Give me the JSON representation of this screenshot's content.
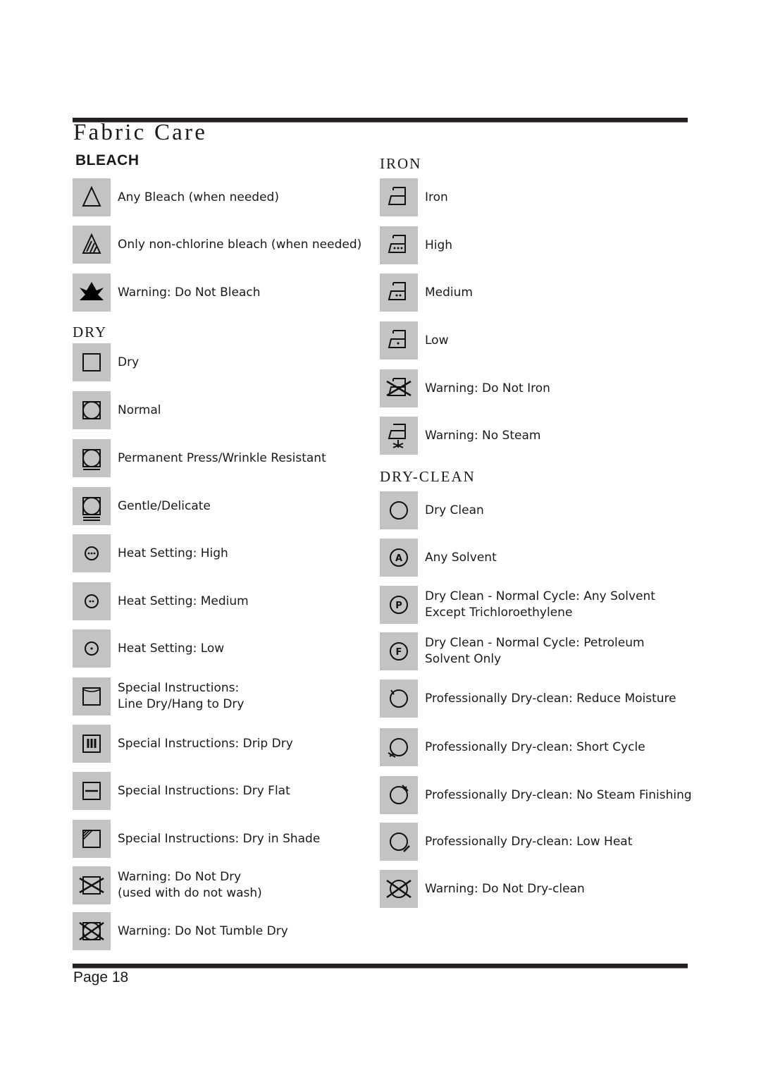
{
  "page": {
    "title": "Fabric Care",
    "footer": "Page 18"
  },
  "sections": {
    "bleach": {
      "title": "BLEACH",
      "items": [
        {
          "icon": "bleach-any-icon",
          "lines": [
            "Any Bleach (when needed)"
          ]
        },
        {
          "icon": "bleach-non-chlorine-icon",
          "lines": [
            "Only non-chlorine bleach (when needed)"
          ]
        },
        {
          "icon": "do-not-bleach-icon",
          "lines": [
            "Warning: Do Not Bleach"
          ]
        }
      ]
    },
    "dry": {
      "title": "DRY",
      "items": [
        {
          "icon": "dry-square-icon",
          "lines": [
            "Dry"
          ]
        },
        {
          "icon": "tumble-dry-normal-icon",
          "lines": [
            "Normal"
          ]
        },
        {
          "icon": "tumble-dry-permanent-press-icon",
          "lines": [
            "Permanent Press/Wrinkle Resistant"
          ]
        },
        {
          "icon": "tumble-dry-gentle-icon",
          "lines": [
            "Gentle/Delicate"
          ]
        },
        {
          "icon": "heat-high-icon",
          "lines": [
            "Heat Setting: High"
          ]
        },
        {
          "icon": "heat-medium-icon",
          "lines": [
            "Heat Setting: Medium"
          ]
        },
        {
          "icon": "heat-low-icon",
          "lines": [
            "Heat Setting: Low"
          ]
        },
        {
          "icon": "line-dry-icon",
          "lines": [
            "Special Instructions:",
            "Line Dry/Hang to Dry"
          ]
        },
        {
          "icon": "drip-dry-icon",
          "lines": [
            "Special Instructions: Drip Dry"
          ]
        },
        {
          "icon": "dry-flat-icon",
          "lines": [
            "Special Instructions: Dry Flat"
          ]
        },
        {
          "icon": "dry-in-shade-icon",
          "lines": [
            "Special Instructions: Dry in Shade"
          ]
        },
        {
          "icon": "do-not-dry-icon",
          "lines": [
            "Warning: Do Not Dry",
            "(used with do not wash)"
          ]
        },
        {
          "icon": "do-not-tumble-dry-icon",
          "lines": [
            "Warning: Do Not Tumble Dry"
          ]
        }
      ]
    },
    "iron": {
      "title": "IRON",
      "items": [
        {
          "icon": "iron-icon",
          "lines": [
            "Iron"
          ]
        },
        {
          "icon": "iron-high-icon",
          "lines": [
            "High"
          ]
        },
        {
          "icon": "iron-medium-icon",
          "lines": [
            "Medium"
          ]
        },
        {
          "icon": "iron-low-icon",
          "lines": [
            "Low"
          ]
        },
        {
          "icon": "do-not-iron-icon",
          "lines": [
            "Warning: Do Not Iron"
          ]
        },
        {
          "icon": "no-steam-icon",
          "lines": [
            "Warning: No Steam"
          ]
        }
      ]
    },
    "dryclean": {
      "title": "DRY-CLEAN",
      "items": [
        {
          "icon": "dry-clean-icon",
          "lines": [
            "Dry Clean"
          ]
        },
        {
          "icon": "dry-clean-any-solvent-icon",
          "lines": [
            "Any Solvent"
          ]
        },
        {
          "icon": "dry-clean-p-icon",
          "lines": [
            "Dry Clean - Normal Cycle: Any Solvent",
            "Except Trichloroethylene"
          ]
        },
        {
          "icon": "dry-clean-f-icon",
          "lines": [
            "Dry Clean - Normal Cycle: Petroleum",
            "Solvent Only"
          ]
        },
        {
          "icon": "dry-clean-reduce-moisture-icon",
          "lines": [
            "Professionally Dry-clean: Reduce Moisture"
          ]
        },
        {
          "icon": "dry-clean-short-cycle-icon",
          "lines": [
            "Professionally Dry-clean: Short Cycle"
          ]
        },
        {
          "icon": "dry-clean-no-steam-icon",
          "lines": [
            "Professionally Dry-clean: No Steam Finishing"
          ]
        },
        {
          "icon": "dry-clean-low-heat-icon",
          "lines": [
            "Professionally Dry-clean: Low Heat"
          ]
        },
        {
          "icon": "do-not-dry-clean-icon",
          "lines": [
            "Warning: Do Not Dry-clean"
          ]
        }
      ]
    }
  }
}
